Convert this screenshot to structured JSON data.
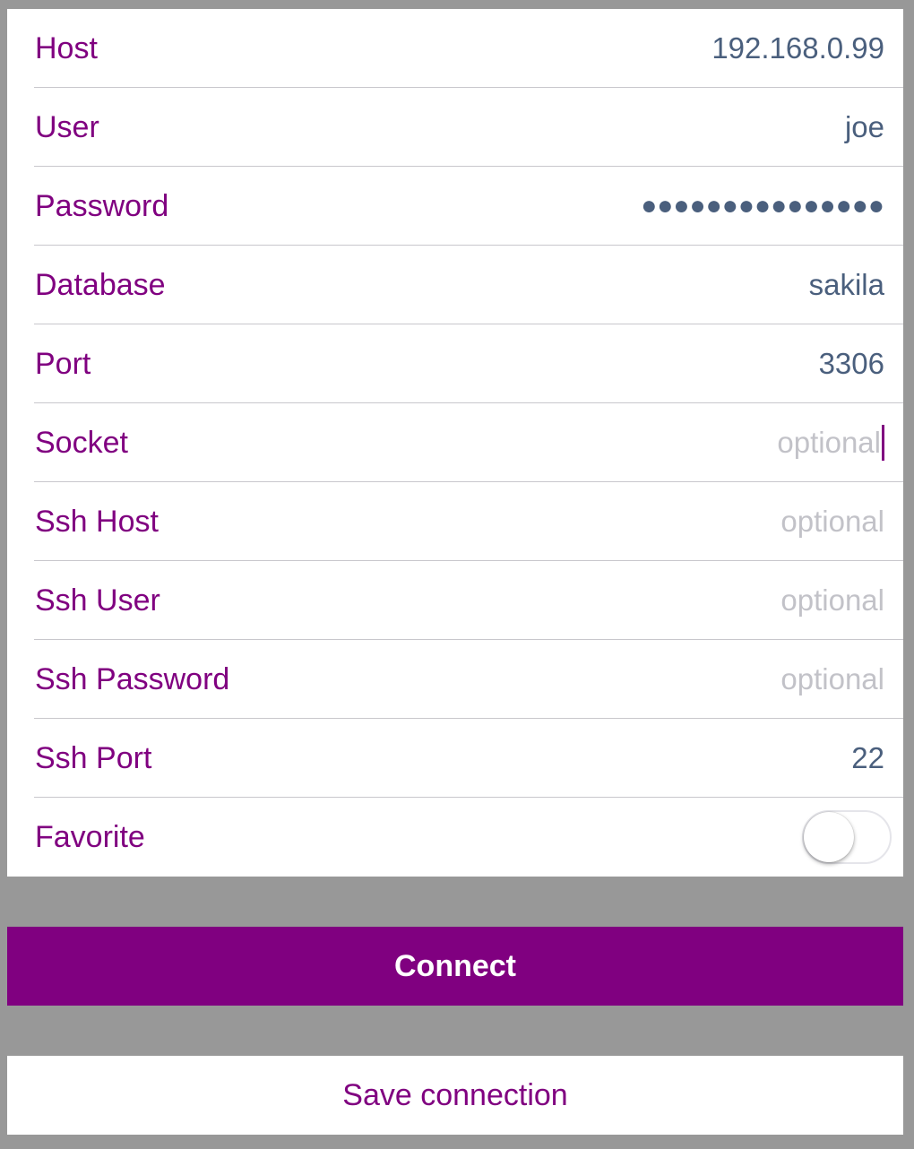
{
  "fields": [
    {
      "label": "Host",
      "value": "192.168.0.99"
    },
    {
      "label": "User",
      "value": "joe"
    },
    {
      "label": "Password",
      "value": "●●●●●●●●●●●●●●●"
    },
    {
      "label": "Database",
      "value": "sakila"
    },
    {
      "label": "Port",
      "value": "3306"
    },
    {
      "label": "Socket",
      "placeholder": "optional"
    },
    {
      "label": "Ssh Host",
      "placeholder": "optional"
    },
    {
      "label": "Ssh User",
      "placeholder": "optional"
    },
    {
      "label": "Ssh Password",
      "placeholder": "optional"
    },
    {
      "label": "Ssh Port",
      "value": "22"
    }
  ],
  "favorite": {
    "label": "Favorite",
    "enabled": false
  },
  "buttons": {
    "connect": "Connect",
    "save": "Save connection"
  },
  "colors": {
    "accent": "#800080",
    "value_text": "#4a5f7d",
    "placeholder_text": "#c2c2c8",
    "background": "#989898"
  }
}
